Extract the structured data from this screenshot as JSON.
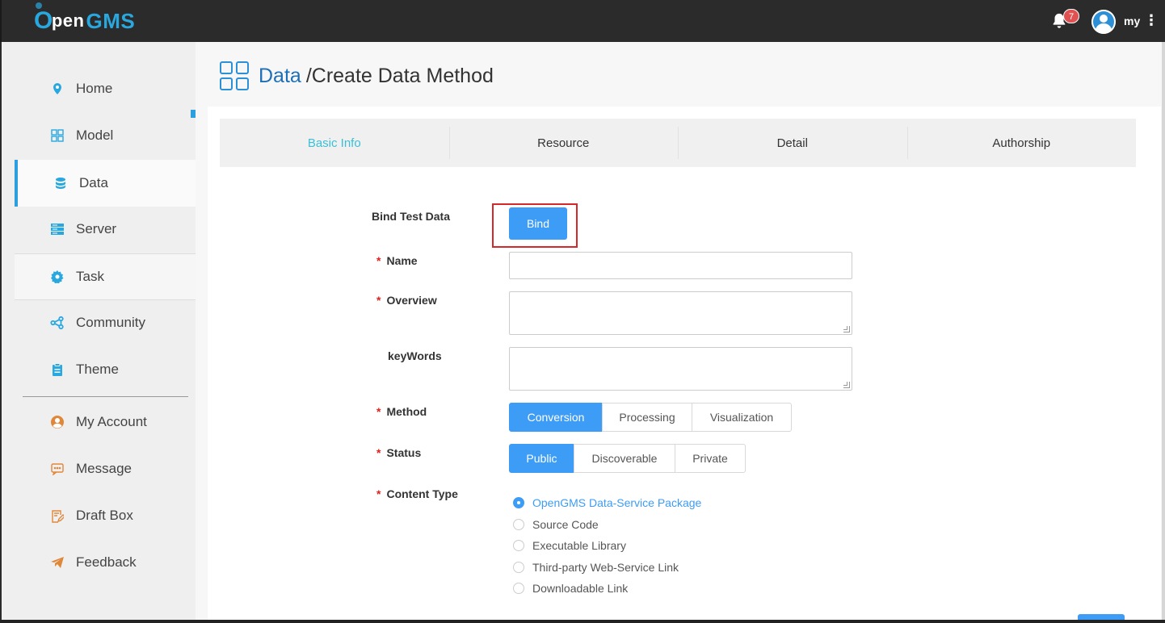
{
  "header": {
    "logo_o": "O",
    "logo_pen": "pen",
    "logo_gms": "GMS",
    "notification_count": "7",
    "username": "my",
    "more_glyph": "⋮"
  },
  "sidebar": {
    "items": [
      {
        "label": "Home",
        "icon": "location-pin-icon"
      },
      {
        "label": "Model",
        "icon": "grid-icon"
      },
      {
        "label": "Data",
        "icon": "database-icon"
      },
      {
        "label": "Server",
        "icon": "server-icon"
      },
      {
        "label": "Task",
        "icon": "gear-icon"
      },
      {
        "label": "Community",
        "icon": "share-nodes-icon"
      },
      {
        "label": "Theme",
        "icon": "clipboard-icon"
      },
      {
        "label": "My Account",
        "icon": "user-circle-icon"
      },
      {
        "label": "Message",
        "icon": "chat-bubble-icon"
      },
      {
        "label": "Draft Box",
        "icon": "edit-note-icon"
      },
      {
        "label": "Feedback",
        "icon": "paper-plane-icon"
      }
    ]
  },
  "page": {
    "breadcrumb_root": "Data",
    "breadcrumb_rest": "/Create Data Method"
  },
  "tabs": [
    "Basic Info",
    "Resource",
    "Detail",
    "Authorship"
  ],
  "form": {
    "bind_label": "Bind Test Data",
    "bind_button": "Bind",
    "name_label": "Name",
    "name_value": "",
    "overview_label": "Overview",
    "overview_value": "",
    "keywords_label": "keyWords",
    "keywords_value": "",
    "method_label": "Method",
    "method_options": [
      "Conversion",
      "Processing",
      "Visualization"
    ],
    "method_selected": "Conversion",
    "status_label": "Status",
    "status_options": [
      "Public",
      "Discoverable",
      "Private"
    ],
    "status_selected": "Public",
    "content_type_label": "Content Type",
    "content_type_options": [
      "OpenGMS Data-Service Package",
      "Source Code",
      "Executable Library",
      "Third-party Web-Service Link",
      "Downloadable Link"
    ],
    "content_type_selected": "OpenGMS Data-Service Package",
    "required_mark": "*"
  },
  "colors": {
    "accent": "#3d9cf5",
    "active_tab": "#3bbfd6",
    "sidebar_icon_blue": "#29a8e0",
    "sidebar_icon_orange": "#e0883a",
    "required": "#e02020",
    "highlight_box": "#d62828"
  }
}
